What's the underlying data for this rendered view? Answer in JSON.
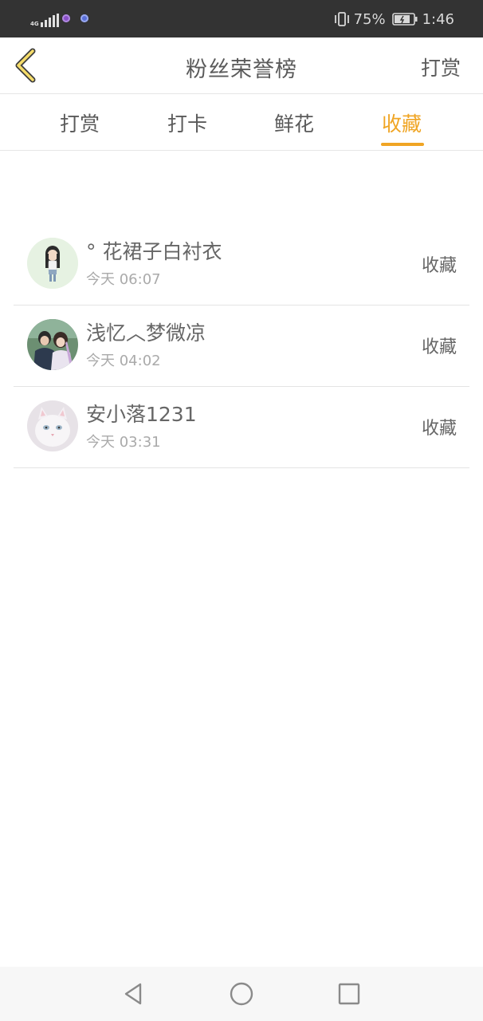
{
  "status_bar": {
    "network_type": "4G",
    "battery_percent": "75%",
    "time": "1:46",
    "icons": [
      "signal-icon",
      "app-notification-icon",
      "browser-notification-icon",
      "vibrate-icon",
      "battery-icon"
    ]
  },
  "header": {
    "back_icon": "chevron-left-icon",
    "title": "粉丝荣誉榜",
    "action_label": "打赏"
  },
  "tabs": [
    {
      "label": "打赏",
      "active": false
    },
    {
      "label": "打卡",
      "active": false
    },
    {
      "label": "鲜花",
      "active": false
    },
    {
      "label": "收藏",
      "active": true
    }
  ],
  "list": [
    {
      "name": "° 花裙子白衬衣",
      "time": "今天  06:07",
      "type": "收藏"
    },
    {
      "name": "浅忆︿梦微凉",
      "time": "今天  04:02",
      "type": "收藏"
    },
    {
      "name": "安小落1231",
      "time": "今天  03:31",
      "type": "收藏"
    }
  ],
  "colors": {
    "accent": "#f0a524",
    "status_bar_bg": "#333333",
    "text": "#5a5a5a",
    "divider": "#e6e6e6"
  },
  "nav_bar": {
    "icons": [
      "back-triangle-icon",
      "home-circle-icon",
      "recents-square-icon"
    ]
  }
}
